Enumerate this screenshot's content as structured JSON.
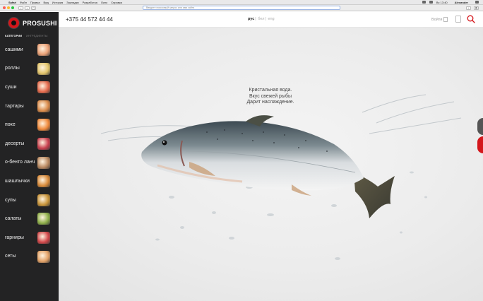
{
  "os_menubar": {
    "items": [
      "Safari",
      "Файл",
      "Правка",
      "Вид",
      "История",
      "Закладки",
      "Разработка",
      "Окно",
      "Справка"
    ],
    "right": [
      "Alexander",
      "Вс 13:40"
    ]
  },
  "browser": {
    "url_placeholder": "Введите поисковый запрос или имя сайта"
  },
  "brand": {
    "name": "PROSUSHI"
  },
  "sidebar": {
    "tabs": [
      {
        "label": "КАТЕГОРИИ",
        "active": true
      },
      {
        "label": "ИНГРЕДИЕНТЫ",
        "active": false
      }
    ],
    "categories": [
      {
        "label": "сашими",
        "color": "#e9a076"
      },
      {
        "label": "роллы",
        "color": "#e2c46b"
      },
      {
        "label": "суши",
        "color": "#e46a4c"
      },
      {
        "label": "тартары",
        "color": "#d98a4a"
      },
      {
        "label": "поке",
        "color": "#f08a3c"
      },
      {
        "label": "десерты",
        "color": "#c9414f"
      },
      {
        "label": "о-бенто ланч",
        "color": "#b88860"
      },
      {
        "label": "шашлычки",
        "color": "#d88a3a"
      },
      {
        "label": "супы",
        "color": "#c8943a"
      },
      {
        "label": "салаты",
        "color": "#8fb04a"
      },
      {
        "label": "гарниры",
        "color": "#d2474a"
      },
      {
        "label": "сеты",
        "color": "#e3a267"
      }
    ]
  },
  "header": {
    "phone": "+375 44 572 44 44",
    "languages": [
      "рус",
      "бел",
      "eng"
    ],
    "active_language": "рус",
    "login_label": "Войти"
  },
  "hero": {
    "line1": "Кристальная вода.",
    "line2": "Вкус свежей рыбы",
    "line3": "Дарит наслаждение."
  },
  "colors": {
    "brand_red": "#d4161b",
    "sidebar_bg": "#232324"
  }
}
